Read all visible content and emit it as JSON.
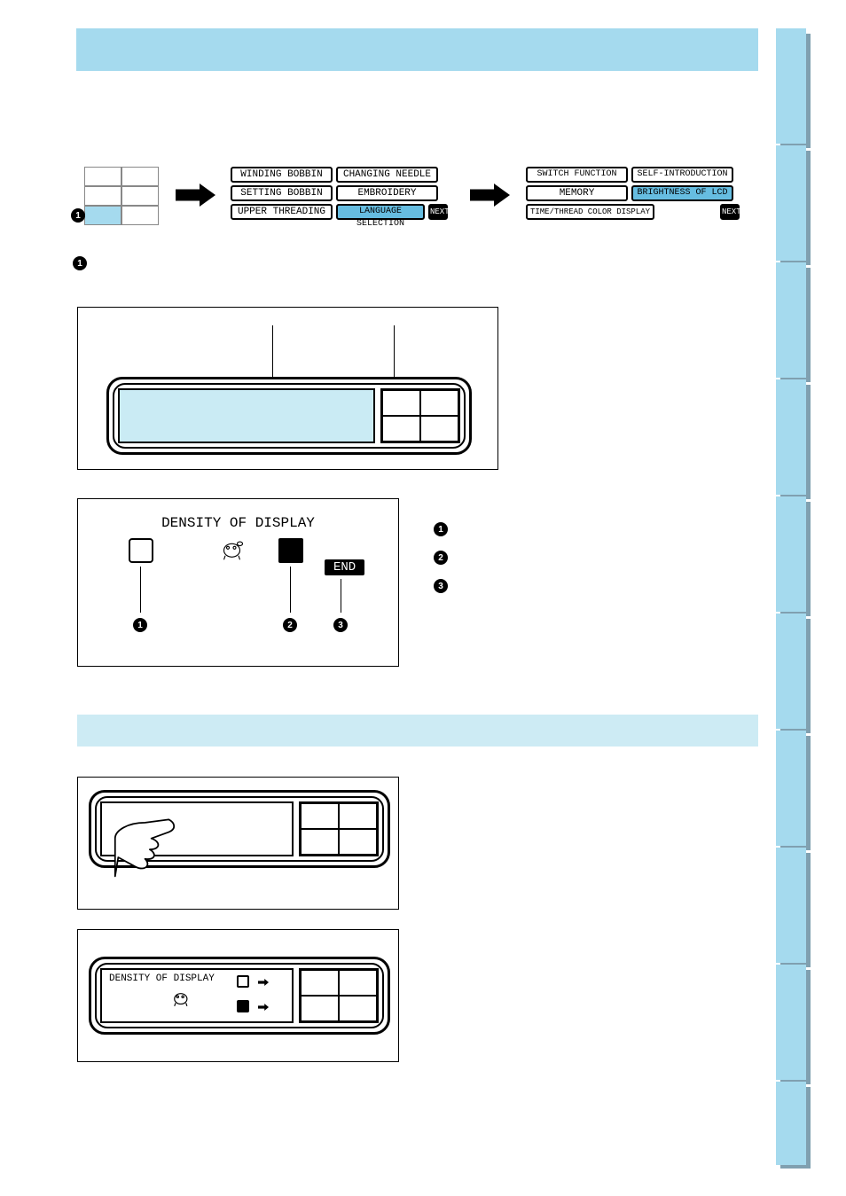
{
  "menu1": {
    "r1a": "WINDING BOBBIN",
    "r1b": "CHANGING NEEDLE",
    "r2a": "SETTING BOBBIN",
    "r2b": "EMBROIDERY",
    "r3a": "UPPER THREADING",
    "r3b": "LANGUAGE SELECTION",
    "next": "NEXT"
  },
  "menu2": {
    "r1a": "SWITCH FUNCTION",
    "r1b": "SELF-INTRODUCTION",
    "r2a": "MEMORY",
    "r2b": "BRIGHTNESS OF LCD",
    "r3a": "TIME/THREAD COLOR DISPLAY",
    "next": "NEXT"
  },
  "density_title": "DENSITY OF DISPLAY",
  "density_title_small": "DENSITY OF DISPLAY",
  "end_label": "END",
  "bullets": {
    "b1": "1",
    "b2": "2",
    "b3": "3"
  }
}
